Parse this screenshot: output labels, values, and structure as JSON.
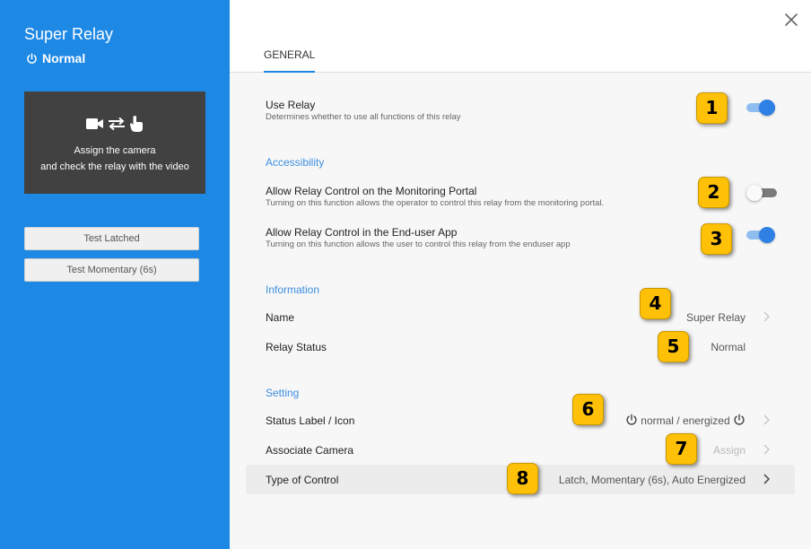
{
  "sidebar": {
    "title": "Super Relay",
    "status": "Normal",
    "camera_box": {
      "line1": "Assign the camera",
      "line2": "and check the relay with the video"
    },
    "buttons": {
      "test_latched": "Test Latched",
      "test_momentary": "Test Momentary (6s)"
    }
  },
  "header": {
    "tab_general": "GENERAL",
    "close_icon": "close-icon"
  },
  "general": {
    "use_relay": {
      "label": "Use Relay",
      "description": "Determines whether to use all functions of this relay",
      "enabled": true
    },
    "accessibility": {
      "heading": "Accessibility",
      "monitoring_portal": {
        "label": "Allow Relay Control on the Monitoring Portal",
        "description": "Turning on this function allows the operator to control this relay from the monitoring portal.",
        "enabled": false
      },
      "enduser_app": {
        "label": "Allow Relay Control in the End-user App",
        "description": "Turning on this function allows the user to control this relay from the enduser app",
        "enabled": true
      }
    },
    "information": {
      "heading": "Information",
      "name_label": "Name",
      "name_value": "Super Relay",
      "status_label": "Relay Status",
      "status_value": "Normal"
    },
    "setting": {
      "heading": "Setting",
      "status_label_label": "Status Label / Icon",
      "status_label_value": "normal / energized",
      "associate_camera_label": "Associate Camera",
      "associate_camera_value": "Assign",
      "type_of_control_label": "Type of Control",
      "type_of_control_value": "Latch, Momentary (6s), Auto Energized"
    }
  },
  "badges": [
    "1",
    "2",
    "3",
    "4",
    "5",
    "6",
    "7",
    "8"
  ],
  "colors": {
    "sidebar": "#1e88e5",
    "accent": "#3d8fe0",
    "toggle_on": "#2f80e4",
    "badge": "#ffc107"
  }
}
